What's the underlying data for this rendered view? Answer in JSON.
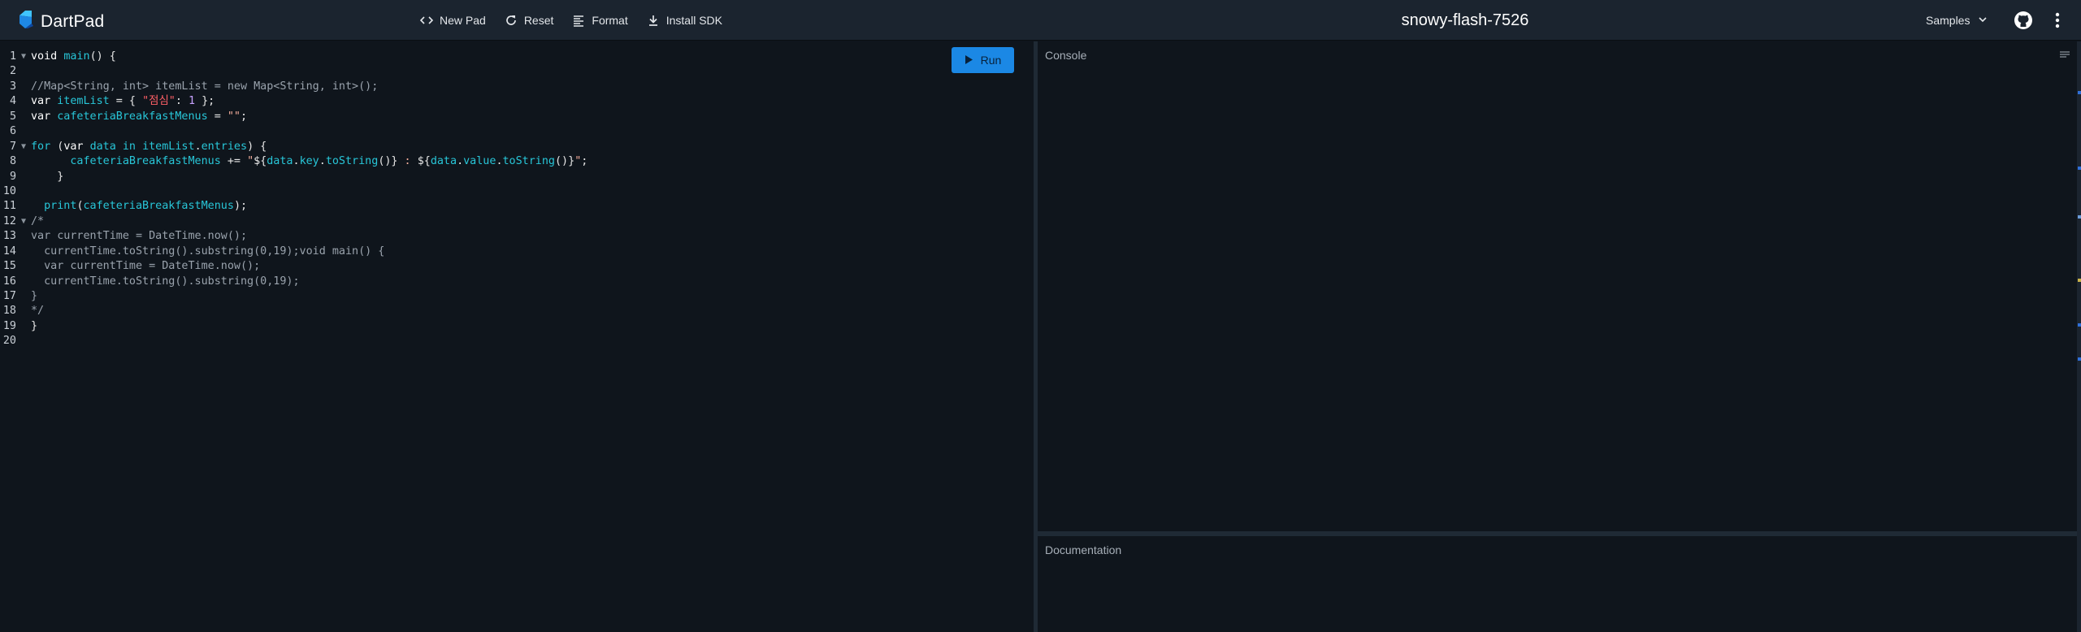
{
  "header": {
    "app_name": "DartPad",
    "toolbar": [
      {
        "label": "New Pad",
        "icon": "code-icon"
      },
      {
        "label": "Reset",
        "icon": "refresh-icon"
      },
      {
        "label": "Format",
        "icon": "format-icon"
      },
      {
        "label": "Install SDK",
        "icon": "download-icon"
      }
    ],
    "pad_title": "snowy-flash-7526",
    "samples_label": "Samples",
    "colors": {
      "header_bg": "#1b242f",
      "run_button": "#1b88e5",
      "logo": "#1e88e5"
    }
  },
  "editor": {
    "run_label": "Run",
    "line_numbers": [
      "1",
      "2",
      "3",
      "4",
      "5",
      "6",
      "7",
      "8",
      "9",
      "10",
      "11",
      "12",
      "13",
      "14",
      "15",
      "16",
      "17",
      "18",
      "19",
      "20"
    ],
    "lines": [
      {
        "fold": true,
        "segments": [
          [
            "kw",
            "void "
          ],
          [
            "fn",
            "main"
          ],
          [
            "src",
            "() {"
          ]
        ]
      },
      {
        "fold": false,
        "segments": []
      },
      {
        "fold": false,
        "segments": [
          [
            "cmt",
            "//Map<String, int> itemList = new Map<String, int>();"
          ]
        ]
      },
      {
        "fold": false,
        "segments": [
          [
            "kw",
            "var "
          ],
          [
            "var",
            "itemList"
          ],
          [
            "src",
            " = { "
          ],
          [
            "str-red",
            "\"점심\""
          ],
          [
            "src",
            ": "
          ],
          [
            "num",
            "1"
          ],
          [
            "src",
            " };"
          ]
        ]
      },
      {
        "fold": false,
        "segments": [
          [
            "kw",
            "var "
          ],
          [
            "var",
            "cafeteriaBreakfastMenus"
          ],
          [
            "src",
            " = "
          ],
          [
            "str",
            "\"\""
          ],
          [
            "src",
            ";"
          ]
        ]
      },
      {
        "fold": false,
        "segments": []
      },
      {
        "fold": true,
        "segments": [
          [
            "kw2",
            "for "
          ],
          [
            "src",
            "("
          ],
          [
            "kw",
            "var "
          ],
          [
            "var",
            "data"
          ],
          [
            "kw2",
            " in "
          ],
          [
            "var",
            "itemList"
          ],
          [
            "src",
            "."
          ],
          [
            "var",
            "entries"
          ],
          [
            "src",
            ") {"
          ]
        ]
      },
      {
        "fold": false,
        "segments": [
          [
            "src",
            "      "
          ],
          [
            "var",
            "cafeteriaBreakfastMenus"
          ],
          [
            "src",
            " += "
          ],
          [
            "str",
            "\""
          ],
          [
            "src",
            "${"
          ],
          [
            "var",
            "data"
          ],
          [
            "src",
            "."
          ],
          [
            "var",
            "key"
          ],
          [
            "src",
            "."
          ],
          [
            "fn",
            "toString"
          ],
          [
            "src",
            "()}"
          ],
          [
            "str",
            " : "
          ],
          [
            "src",
            "${"
          ],
          [
            "var",
            "data"
          ],
          [
            "src",
            "."
          ],
          [
            "var",
            "value"
          ],
          [
            "src",
            "."
          ],
          [
            "fn",
            "toString"
          ],
          [
            "src",
            "()}"
          ],
          [
            "str",
            "\""
          ],
          [
            "src",
            ";"
          ]
        ]
      },
      {
        "fold": false,
        "segments": [
          [
            "src",
            "    }"
          ]
        ]
      },
      {
        "fold": false,
        "segments": []
      },
      {
        "fold": false,
        "segments": [
          [
            "src",
            "  "
          ],
          [
            "fn",
            "print"
          ],
          [
            "src",
            "("
          ],
          [
            "var",
            "cafeteriaBreakfastMenus"
          ],
          [
            "src",
            ");"
          ]
        ]
      },
      {
        "fold": true,
        "segments": [
          [
            "cmt",
            "/*"
          ]
        ]
      },
      {
        "fold": false,
        "segments": [
          [
            "cmt",
            "var currentTime = DateTime.now();"
          ]
        ]
      },
      {
        "fold": false,
        "segments": [
          [
            "cmt",
            "  currentTime.toString().substring(0,19);void main() {"
          ]
        ]
      },
      {
        "fold": false,
        "segments": [
          [
            "cmt",
            "  var currentTime = DateTime.now();"
          ]
        ]
      },
      {
        "fold": false,
        "segments": [
          [
            "cmt",
            "  currentTime.toString().substring(0,19);"
          ]
        ]
      },
      {
        "fold": false,
        "segments": [
          [
            "cmt",
            "}"
          ]
        ]
      },
      {
        "fold": false,
        "segments": [
          [
            "cmt",
            "*/"
          ]
        ]
      },
      {
        "fold": false,
        "segments": [
          [
            "src",
            "}"
          ]
        ]
      },
      {
        "fold": false,
        "segments": []
      }
    ]
  },
  "console": {
    "label": "Console"
  },
  "documentation": {
    "label": "Documentation"
  }
}
